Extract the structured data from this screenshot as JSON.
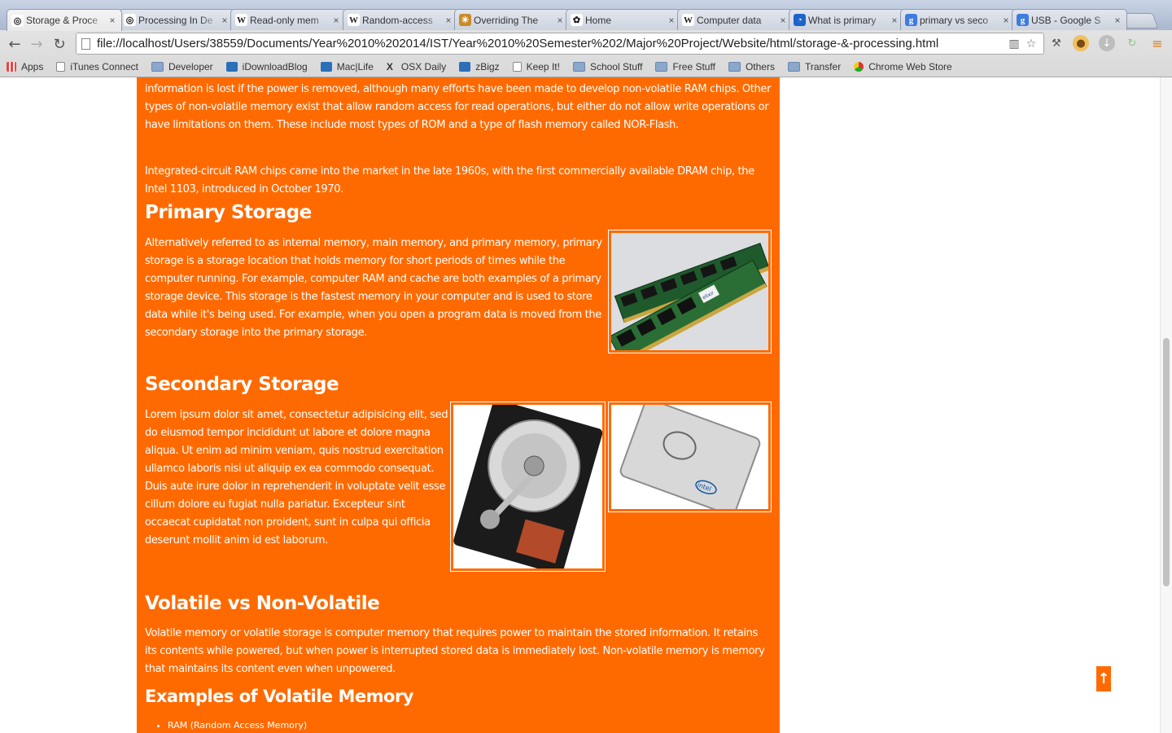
{
  "tabs": [
    {
      "title": "Storage & Proce",
      "icon": "globe-icon",
      "active": true
    },
    {
      "title": "Processing In De",
      "icon": "globe-icon"
    },
    {
      "title": "Read-only mem",
      "icon": "wikipedia-icon"
    },
    {
      "title": "Random-access",
      "icon": "wikipedia-icon"
    },
    {
      "title": "Overriding The",
      "icon": "star-icon"
    },
    {
      "title": "Home",
      "icon": "flower-icon"
    },
    {
      "title": "Computer data",
      "icon": "wikipedia-icon"
    },
    {
      "title": "What is primary",
      "icon": "site-icon"
    },
    {
      "title": "primary vs seco",
      "icon": "google-icon"
    },
    {
      "title": "USB - Google S",
      "icon": "google-icon"
    }
  ],
  "toolbar": {
    "url": "file://localhost/Users/38559/Documents/Year%2010%202014/IST/Year%2010%20Semester%202/Major%20Project/Website/html/storage-&-processing.html"
  },
  "bookmarks": [
    {
      "label": "Apps",
      "icon": "apps-grid-icon"
    },
    {
      "label": "iTunes Connect",
      "icon": "page-icon"
    },
    {
      "label": "Developer",
      "icon": "folder-icon"
    },
    {
      "label": "iDownloadBlog",
      "icon": "site-icon"
    },
    {
      "label": "Mac|Life",
      "icon": "site-icon"
    },
    {
      "label": "OSX Daily",
      "icon": "x-icon"
    },
    {
      "label": "zBigz",
      "icon": "site-icon"
    },
    {
      "label": "Keep It!",
      "icon": "page-icon"
    },
    {
      "label": "School Stuff",
      "icon": "folder-icon"
    },
    {
      "label": "Free Stuff",
      "icon": "folder-icon"
    },
    {
      "label": "Others",
      "icon": "folder-icon"
    },
    {
      "label": "Transfer",
      "icon": "folder-icon"
    },
    {
      "label": "Chrome Web Store",
      "icon": "chrome-store-icon"
    }
  ],
  "page": {
    "accent_color": "#ff6a00",
    "intro_tail": "strict sense. RAM is normally associated with volatile types of memory (such as DRAM memory modules), where stored information is lost if the power is removed, although many efforts have been made to develop non-volatile RAM chips. Other types of non-volatile memory exist that allow random access for read operations, but either do not allow write operations or have limitations on them. These include most types of ROM and a type of flash memory called NOR-Flash.",
    "intro_2": "Integrated-circuit RAM chips came into the market in the late 1960s, with the first commercially available DRAM chip, the Intel 1103, introduced in October 1970.",
    "primary_heading": "Primary Storage",
    "primary_text": "Alternatively referred to as internal memory, main memory, and primary memory, primary storage is a storage location that holds memory for short periods of times while the computer running. For example, computer RAM and cache are both examples of a primary storage device. This storage is the fastest memory in your computer and is used to store data while it's being used. For example, when you open a program data is moved from the secondary storage into the primary storage.",
    "secondary_heading": "Secondary Storage",
    "secondary_text": "Lorem ipsum dolor sit amet, consectetur adipisicing elit, sed do eiusmod tempor incididunt ut labore et dolore magna aliqua. Ut enim ad minim veniam, quis nostrud exercitation ullamco laboris nisi ut aliquip ex ea commodo consequat. Duis aute irure dolor in reprehenderit in voluptate velit esse cillum dolore eu fugiat nulla pariatur. Excepteur sint occaecat cupidatat non proident, sunt in culpa qui officia deserunt mollit anim id est laborum.",
    "volatile_heading": "Volatile vs Non-Volatile",
    "volatile_text": "Volatile memory or volatile storage is computer memory that requires power to maintain the stored information. It retains its contents while powered, but when power is interrupted stored data is immediately lost. Non-volatile memory is memory that maintains its content even when unpowered.",
    "examples_heading": "Examples of Volatile Memory",
    "examples": [
      "RAM (Random Access Memory)"
    ],
    "ssd_brand": "intel",
    "ram_brand": "elixir",
    "back_to_top": "↑"
  }
}
